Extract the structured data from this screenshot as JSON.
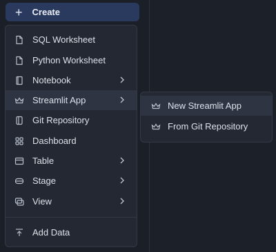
{
  "create_button": {
    "label": "Create",
    "icon": "plus-icon"
  },
  "menu": {
    "items": [
      {
        "label": "SQL Worksheet",
        "icon": "file-icon"
      },
      {
        "label": "Python Worksheet",
        "icon": "file-icon"
      },
      {
        "label": "Notebook",
        "icon": "notebook-icon",
        "has_submenu": true
      },
      {
        "label": "Streamlit App",
        "icon": "streamlit-crown-icon",
        "has_submenu": true,
        "active": true
      },
      {
        "label": "Git Repository",
        "icon": "git-repository-icon"
      },
      {
        "label": "Dashboard",
        "icon": "dashboard-grid-icon"
      },
      {
        "label": "Table",
        "icon": "table-icon",
        "has_submenu": true
      },
      {
        "label": "Stage",
        "icon": "stage-icon",
        "has_submenu": true
      },
      {
        "label": "View",
        "icon": "view-icon",
        "has_submenu": true
      },
      {
        "label": "Add Data",
        "icon": "upload-icon"
      }
    ]
  },
  "submenu": {
    "items": [
      {
        "label": "New Streamlit App",
        "icon": "streamlit-crown-icon",
        "active": true
      },
      {
        "label": "From Git Repository",
        "icon": "streamlit-crown-icon"
      }
    ]
  },
  "colors": {
    "background": "#1a1e26",
    "menu": "#232832",
    "accent_button": "#2a3a5e",
    "hover": "#2e3442"
  }
}
